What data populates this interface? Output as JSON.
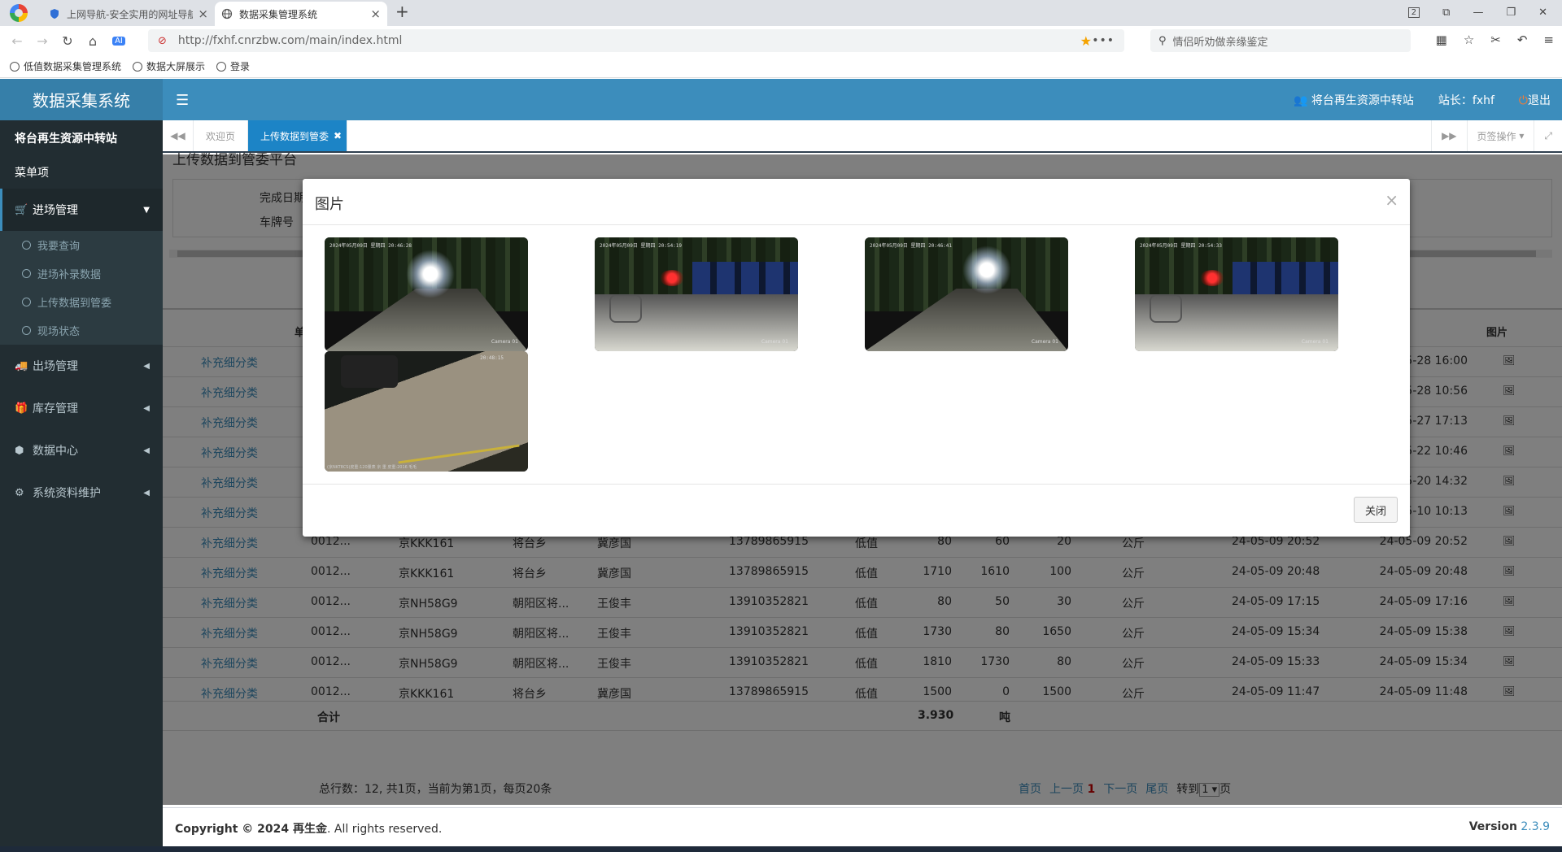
{
  "browser": {
    "tabs": [
      {
        "title": "上网导航-安全实用的网址导航",
        "active": false
      },
      {
        "title": "数据采集管理系统",
        "active": true
      }
    ],
    "new_tab": "+",
    "window_controls": [
      "2",
      "⧉",
      "—",
      "❐",
      "✕"
    ],
    "url": "http://fxhf.cnrzbw.com/main/index.html",
    "search_placeholder": "情侣听劝做亲缘鉴定",
    "bookmarks": [
      "低值数据采集管理系统",
      "数据大屏展示",
      "登录"
    ]
  },
  "app": {
    "logo": "数据采集系统",
    "station_link": "将台再生资源中转站",
    "user": "站长：fxhf",
    "logout": "退出"
  },
  "sidebar": {
    "user_name": "将台再生资源中转站",
    "header": "菜单项",
    "items": [
      {
        "label": "进场管理",
        "icon": "cart-icon",
        "active": true,
        "children": [
          "我要查询",
          "进场补录数据",
          "上传数据到管委",
          "现场状态"
        ]
      },
      {
        "label": "出场管理",
        "icon": "truck-icon"
      },
      {
        "label": "库存管理",
        "icon": "gift-icon"
      },
      {
        "label": "数据中心",
        "icon": "cubes-icon"
      },
      {
        "label": "系统资料维护",
        "icon": "cogs-icon"
      }
    ]
  },
  "page_tabs": {
    "tabs": [
      "欢迎页",
      "上传数据到管委"
    ],
    "active": "上传数据到管委",
    "ops_label": "页签操作"
  },
  "content": {
    "title": "上传数据到管委平台",
    "filters": [
      "完成日期",
      "车牌号"
    ],
    "image_col_header": "图片",
    "short_header": "单",
    "rows": [
      {
        "action": "补充细分类",
        "end": "24-05-28 16:00"
      },
      {
        "action": "补充细分类",
        "end": "24-05-28 10:56"
      },
      {
        "action": "补充细分类",
        "end": "24-05-27 17:13"
      },
      {
        "action": "补充细分类",
        "end": "24-05-22 10:46"
      },
      {
        "action": "补充细分类",
        "end": "24-05-20 14:32"
      },
      {
        "action": "补充细分类",
        "end": "24-05-10 10:13"
      },
      {
        "action": "补充细分类",
        "no": "0012...",
        "plate": "京KKK161",
        "area": "将台乡",
        "name": "冀彦国",
        "phone": "13789865915",
        "type": "低值",
        "gross": "80",
        "tare": "60",
        "net": "20",
        "unit": "公斤",
        "start": "24-05-09 20:52",
        "end": "24-05-09 20:52"
      },
      {
        "action": "补充细分类",
        "no": "0012...",
        "plate": "京KKK161",
        "area": "将台乡",
        "name": "冀彦国",
        "phone": "13789865915",
        "type": "低值",
        "gross": "1710",
        "tare": "1610",
        "net": "100",
        "unit": "公斤",
        "start": "24-05-09 20:48",
        "end": "24-05-09 20:48"
      },
      {
        "action": "补充细分类",
        "no": "0012...",
        "plate": "京NH58G9",
        "area": "朝阳区将...",
        "name": "王俊丰",
        "phone": "13910352821",
        "type": "低值",
        "gross": "80",
        "tare": "50",
        "net": "30",
        "unit": "公斤",
        "start": "24-05-09 17:15",
        "end": "24-05-09 17:16"
      },
      {
        "action": "补充细分类",
        "no": "0012...",
        "plate": "京NH58G9",
        "area": "朝阳区将...",
        "name": "王俊丰",
        "phone": "13910352821",
        "type": "低值",
        "gross": "1730",
        "tare": "80",
        "net": "1650",
        "unit": "公斤",
        "start": "24-05-09 15:34",
        "end": "24-05-09 15:38"
      },
      {
        "action": "补充细分类",
        "no": "0012...",
        "plate": "京NH58G9",
        "area": "朝阳区将...",
        "name": "王俊丰",
        "phone": "13910352821",
        "type": "低值",
        "gross": "1810",
        "tare": "1730",
        "net": "80",
        "unit": "公斤",
        "start": "24-05-09 15:33",
        "end": "24-05-09 15:34"
      },
      {
        "action": "补充细分类",
        "no": "0012...",
        "plate": "京KKK161",
        "area": "将台乡",
        "name": "冀彦国",
        "phone": "13789865915",
        "type": "低值",
        "gross": "1500",
        "tare": "0",
        "net": "1500",
        "unit": "公斤",
        "start": "24-05-09 11:47",
        "end": "24-05-09 11:48"
      }
    ],
    "sum_label": "合计",
    "sum_value": "3.930",
    "sum_unit": "吨",
    "pager_info": "总行数：12, 共1页，当前为第1页，每页20条",
    "pager_first": "首页",
    "pager_prev": "上一页",
    "pager_current": "1",
    "pager_next": "下一页",
    "pager_last": "尾页",
    "pager_goto": "转到",
    "pager_page_value": "1",
    "pager_page_unit": "页"
  },
  "footer": {
    "copyright_prefix": "Copyright © 2024 ",
    "company": "再生金",
    "rights": ". All rights reserved.",
    "version_label": "Version",
    "version": "2.3.9"
  },
  "modal": {
    "title": "图片",
    "close_x": "×",
    "close_button": "关闭",
    "photos": [
      {
        "stamp": "2024年05月09日 星期四 20:46:28",
        "camera": "Camera 01"
      },
      {
        "stamp": "2024年05月09日 星期四 20:54:19",
        "camera": "Camera 01"
      },
      {
        "stamp": "2024年05月09日 星期四 20:46:41",
        "camera": "Camera 01"
      },
      {
        "stamp": "2024年05月09日 星期四 20:54:33",
        "camera": "Camera 01"
      },
      {
        "stamp": "20:48:15",
        "camera": "(京NKT8CS)皮重:120量表 京 重 皮重:2016 毛毛"
      }
    ]
  }
}
